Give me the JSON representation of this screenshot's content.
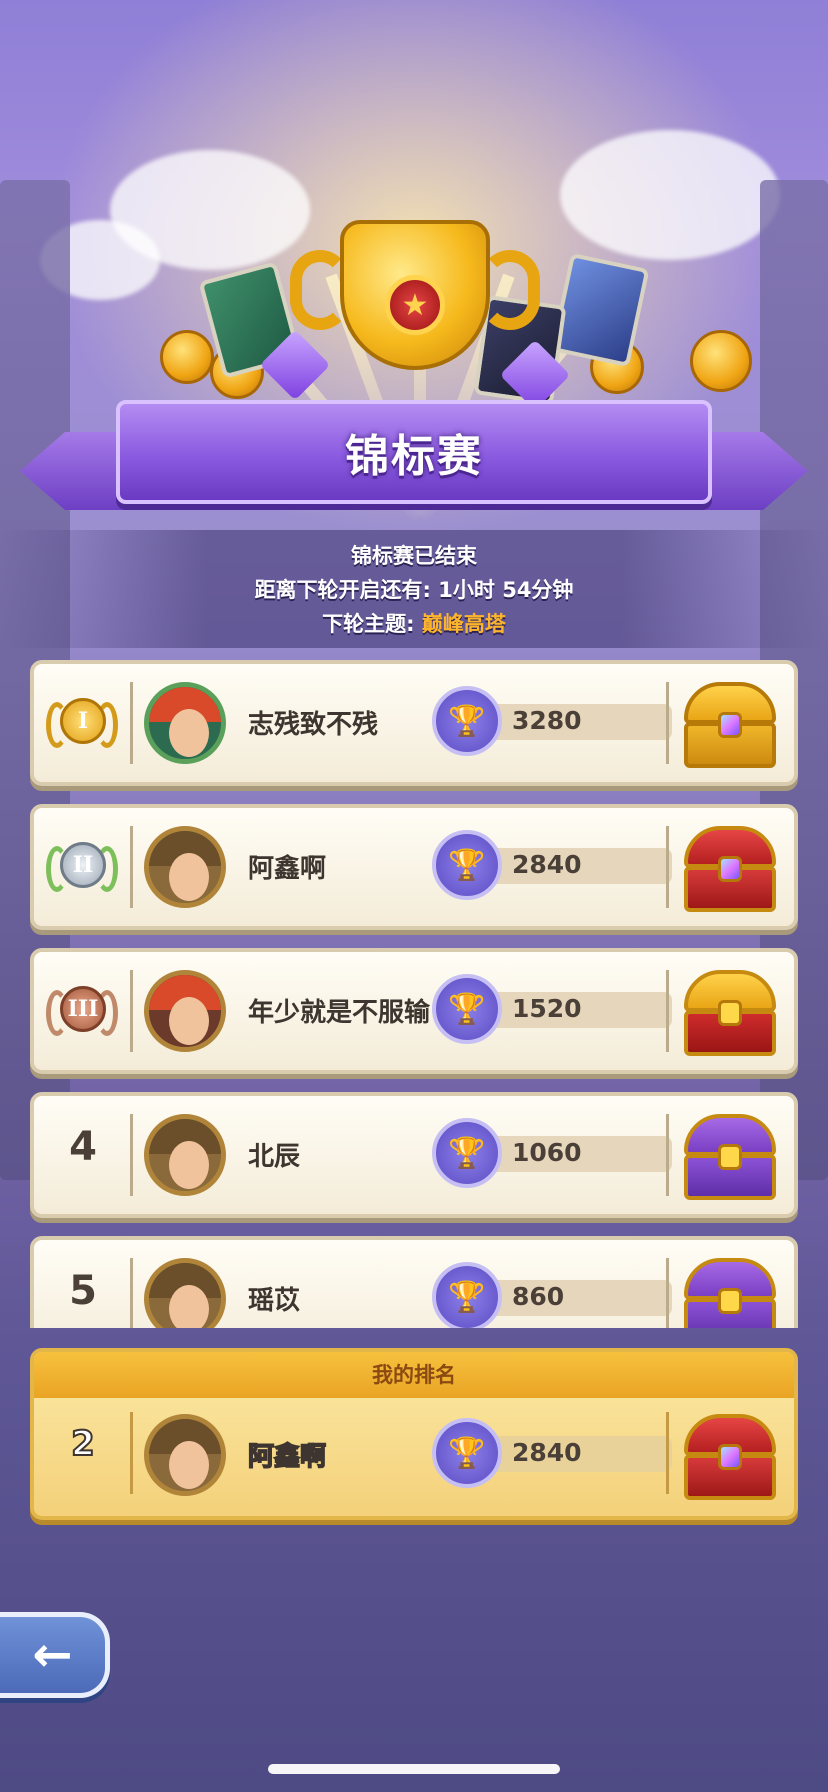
{
  "banner": {
    "title": "锦标赛"
  },
  "info": {
    "status": "锦标赛已结束",
    "countdown_label": "距离下轮开启还有:",
    "countdown_value": "1小时 54分钟",
    "theme_label": "下轮主题:",
    "theme_value": "巅峰高塔"
  },
  "leaderboard": [
    {
      "rank": "1",
      "name": "志残致不残",
      "score": "3280",
      "medal": "I",
      "chest": "legendary"
    },
    {
      "rank": "2",
      "name": "阿鑫啊",
      "score": "2840",
      "medal": "II",
      "chest": "epic-red"
    },
    {
      "rank": "3",
      "name": "年少就是不服输",
      "score": "1520",
      "medal": "III",
      "chest": "gold-red"
    },
    {
      "rank": "4",
      "name": "北辰",
      "score": "1060",
      "chest": "purple-gold"
    },
    {
      "rank": "5",
      "name": "瑶苡",
      "score": "860",
      "chest": "purple-gold"
    }
  ],
  "my_rank": {
    "header": "我的排名",
    "rank": "2",
    "name": "阿鑫啊",
    "score": "2840"
  },
  "icons": {
    "back": "back-arrow-icon",
    "trophy": "trophy-icon",
    "chest": "treasure-chest-icon"
  },
  "colors": {
    "banner": "#8a5ae0",
    "highlight": "#ffb52b",
    "row_bg": "#fffdf6",
    "my_rank_bg": "#f4d17a"
  }
}
